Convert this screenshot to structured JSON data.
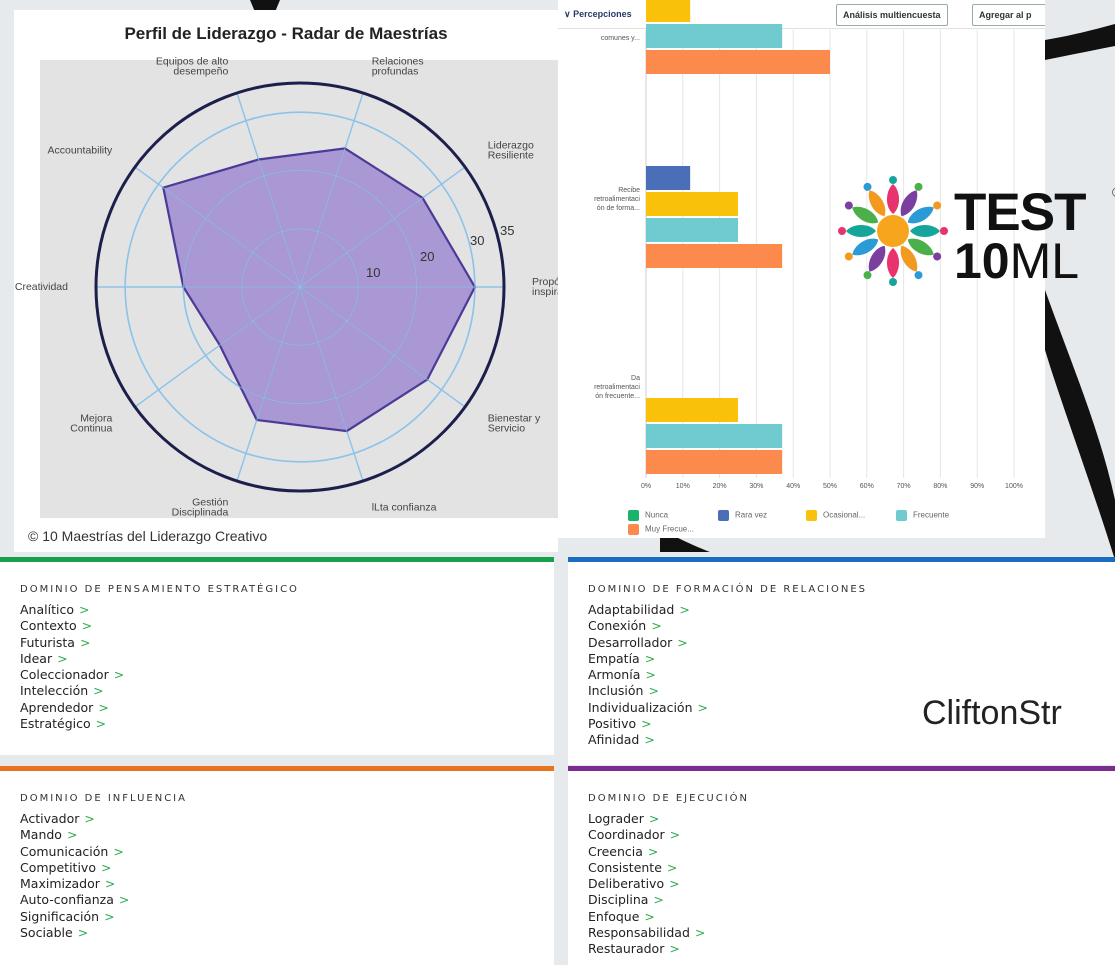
{
  "radar": {
    "title": "Perfil de Liderazgo - Radar de Maestrías",
    "footer": "© 10 Maestrías del Liderazgo Creativo",
    "axes": [
      {
        "label": [
          "Relaciones",
          "profundas"
        ]
      },
      {
        "label": [
          "Liderazgo",
          "Resiliente"
        ]
      },
      {
        "label": [
          "Propósito e",
          "inspiración"
        ]
      },
      {
        "label": [
          "Bienestar y",
          "Servicio"
        ]
      },
      {
        "label": [
          "lLta confianza"
        ]
      },
      {
        "label": [
          "Gestión",
          "Disciplinada"
        ]
      },
      {
        "label": [
          "Mejora",
          "Continua"
        ]
      },
      {
        "label": [
          "Creatividad"
        ]
      },
      {
        "label": [
          "Accountability"
        ]
      },
      {
        "label": [
          "Equipos de alto",
          "desempeño"
        ]
      }
    ],
    "ticks": [
      "10",
      "20",
      "30",
      "35"
    ],
    "colors": {
      "fill": "#a28fd0",
      "stroke": "#4b3a96",
      "grid": "#8cc3ea",
      "outer": "#1b1f4a",
      "background": "#e3e3e3"
    }
  },
  "chart_data": {
    "type": "radar",
    "title": "Perfil de Liderazgo - Radar de Maestrías",
    "categories": [
      "Relaciones profundas",
      "Liderazgo Resiliente",
      "Propósito e inspiración",
      "Bienestar y Servicio",
      "lLta confianza",
      "Gestión Disciplinada",
      "Mejora Continua",
      "Creatividad",
      "Accountability",
      "Equipos de alto desempeño"
    ],
    "values": [
      25,
      26,
      30,
      27,
      26,
      24,
      17,
      20,
      29,
      23
    ],
    "rlim": [
      0,
      35
    ],
    "grid": true
  },
  "bar_chart_data": {
    "type": "bar",
    "orientation": "horizontal",
    "x_ticks": [
      "0%",
      "10%",
      "20%",
      "30%",
      "40%",
      "50%",
      "60%",
      "70%",
      "80%",
      "90%",
      "100%"
    ],
    "categories": [
      {
        "label": [
          "comunes y..."
        ]
      },
      {
        "label": [
          "Recibe",
          "retroalimentaci",
          "ón de forma..."
        ]
      },
      {
        "label": [
          "Da",
          "retroalimentaci",
          "ón frecuente..."
        ]
      }
    ],
    "series": [
      {
        "name": "Nunca",
        "color": "#19b36b",
        "values": [
          null,
          null,
          null
        ]
      },
      {
        "name": "Rara vez",
        "color": "#4a6fb8",
        "values": [
          null,
          12,
          null
        ]
      },
      {
        "name": "Ocasional...",
        "color": "#f9c10a",
        "values": [
          12,
          25,
          25
        ]
      },
      {
        "name": "Frecuente",
        "color": "#6fcbd0",
        "values": [
          37,
          25,
          37
        ]
      },
      {
        "name": "Muy Frecue...",
        "color": "#fd8a4d",
        "values": [
          50,
          37,
          37
        ]
      }
    ]
  },
  "bar_panel": {
    "dropdown": "Percepciones",
    "btn_analysis": "Análisis multiencuesta",
    "btn_add": "Agregar al p"
  },
  "logo": {
    "test": "TEST",
    "ten": "10",
    "ml": "ML",
    "reg": "®"
  },
  "clifton": {
    "word": "CliftonStr",
    "chevron": ">",
    "domains": [
      {
        "title": "DOMINIO DE PENSAMIENTO ESTRATÉGICO",
        "color": "#18a14a",
        "items": [
          "Analítico",
          "Contexto",
          "Futurista",
          "Idear",
          "Coleccionador",
          "Intelección",
          "Aprendedor",
          "Estratégico"
        ]
      },
      {
        "title": "DOMINIO DE FORMACIÓN DE RELACIONES",
        "color": "#1a6bc2",
        "items": [
          "Adaptabilidad",
          "Conexión",
          "Desarrollador",
          "Empatía",
          "Armonía",
          "Inclusión",
          "Individualización",
          "Positivo",
          "Afinidad"
        ]
      },
      {
        "title": "DOMINIO DE INFLUENCIA",
        "color": "#ea7320",
        "items": [
          "Activador",
          "Mando",
          "Comunicación",
          "Competitivo",
          "Maximizador",
          "Auto-confianza",
          "Significación",
          "Sociable"
        ]
      },
      {
        "title": "DOMINIO DE EJECUCIÓN",
        "color": "#7a2d8c",
        "items": [
          "Lograder",
          "Coordinador",
          "Creencia",
          "Consistente",
          "Deliberativo",
          "Disciplina",
          "Enfoque",
          "Responsabilidad",
          "Restaurador"
        ]
      }
    ]
  }
}
